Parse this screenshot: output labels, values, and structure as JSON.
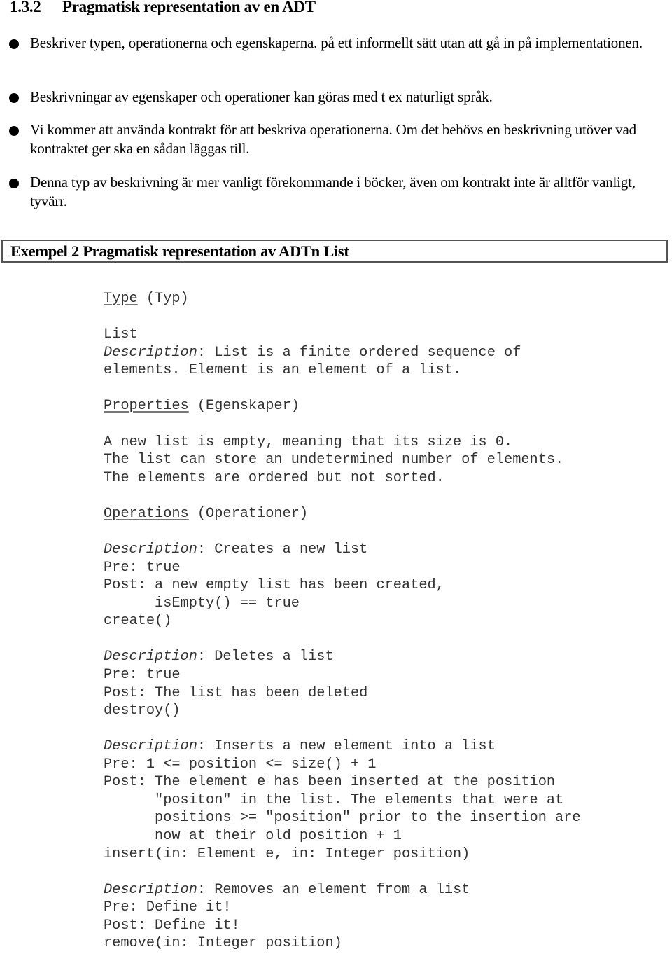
{
  "section": {
    "number": "1.3.2",
    "title": "Pragmatisk representation av en ADT"
  },
  "bullets": [
    {
      "text": "Beskriver typen, operationerna och egenskaperna. på ett informellt sätt utan att gå in på implementationen."
    },
    {
      "text": "Beskrivningar av egenskaper och operationer kan göras med t ex naturligt språk."
    },
    {
      "text": "Vi kommer att använda kontrakt för att beskriva operationerna. Om det behövs en beskrivning utöver vad kontraktet ger ska en sådan läggas till."
    },
    {
      "text": "Denna typ av beskrivning är mer vanligt förekommande i böcker, även om kontrakt inte är alltför vanligt, tyvärr."
    }
  ],
  "example": {
    "title": "Exempel 2 Pragmatisk representation av ADTn List",
    "type_section": {
      "heading": "Type",
      "heading_translation": " (Typ)",
      "name": "List",
      "description_label": "Description",
      "description_line1": ": List is a finite ordered sequence of",
      "description_line2": "elements. Element is an element of a list."
    },
    "properties_section": {
      "heading": "Properties",
      "heading_translation": " (Egenskaper)",
      "lines": [
        "A new list is empty, meaning that its size is 0.",
        "The list can store an undetermined number of elements.",
        "The elements are ordered but not sorted."
      ]
    },
    "operations_section": {
      "heading": "Operations",
      "heading_translation": " (Operationer)",
      "description_label": "Description",
      "operations": [
        {
          "description": ": Creates a new list",
          "pre": "Pre: true",
          "post": [
            "Post: a new empty list has been created,",
            "      isEmpty() == true"
          ],
          "signature": "create()"
        },
        {
          "description": ": Deletes a list",
          "pre": "Pre: true",
          "post": [
            "Post: The list has been deleted"
          ],
          "signature": "destroy()"
        },
        {
          "description": ": Inserts a new element into a list",
          "pre": "Pre: 1 <= position <= size() + 1",
          "post": [
            "Post: The element e has been inserted at the position",
            "      \"positon\" in the list. The elements that were at",
            "      positions >= \"position\" prior to the insertion are",
            "      now at their old position + 1"
          ],
          "signature": "insert(in: Element e, in: Integer position)"
        },
        {
          "description": ": Removes an element from a list",
          "pre": "Pre: Define it!",
          "post": [
            "Post: Define it!"
          ],
          "signature": "remove(in: Integer position)"
        }
      ]
    }
  }
}
